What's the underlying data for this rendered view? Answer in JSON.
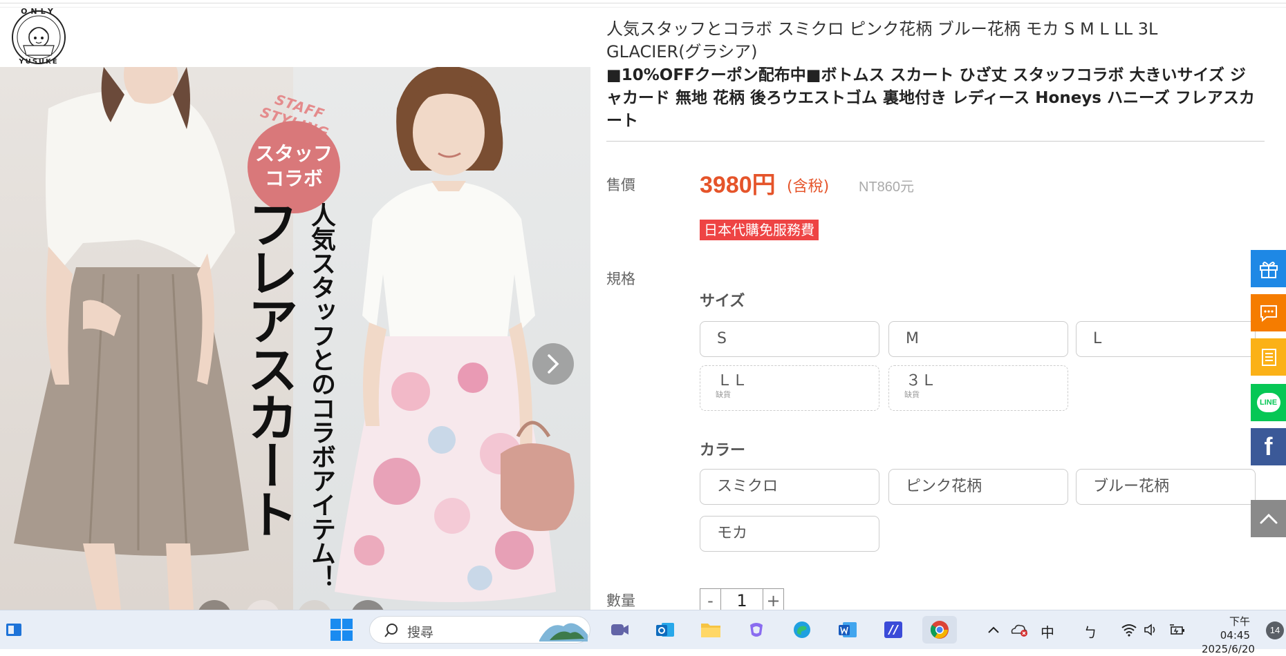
{
  "logo": {
    "top_text": "ONLY",
    "bottom_text": "YUSUKE"
  },
  "product": {
    "title": "人気スタッフとコラボ スミクロ ピンク花柄 ブルー花柄 モカ S M L LL 3L GLACIER(グラシア)",
    "subtitle": "■10%OFFクーポン配布中■ボトムス スカート ひざ丈 スタッフコラボ 大きいサイズ ジャカード 無地 花柄 後ろウエストゴム 裏地付き レディース Honeys ハニーズ フレアスカート"
  },
  "hero": {
    "staff_styling": "STAFF STYLING",
    "badge_line1": "スタッフ",
    "badge_line2": "コラボ",
    "vertical_big": "フレアスカート",
    "vertical_small": "人気スタッフとのコラボアイテム！",
    "next_icon": "chevron-right-icon"
  },
  "pricing": {
    "label": "售價",
    "price": "3980円",
    "tax": "(含稅)",
    "nt": "NT860元",
    "service_badge": "日本代購免服務費"
  },
  "spec": {
    "label": "規格",
    "size_heading": "サイズ",
    "sizes": [
      {
        "label": "S",
        "note": ""
      },
      {
        "label": "M",
        "note": ""
      },
      {
        "label": "L",
        "note": ""
      },
      {
        "label": "ＬＬ",
        "note": "缺貨"
      },
      {
        "label": "３Ｌ",
        "note": "缺貨"
      }
    ],
    "color_heading": "カラー",
    "colors": [
      "スミクロ",
      "ピンク花柄",
      "ブルー花柄",
      "モカ"
    ]
  },
  "quantity": {
    "label": "數量",
    "minus": "-",
    "value": "1",
    "plus": "+"
  },
  "side_buttons": [
    {
      "icon": "gift-icon",
      "color": "#1e88e5"
    },
    {
      "icon": "chat-icon",
      "color": "#f57c00"
    },
    {
      "icon": "notes-icon",
      "color": "#fbb117"
    },
    {
      "icon": "line-icon",
      "label": "LINE",
      "color": "#06c755"
    },
    {
      "icon": "facebook-icon",
      "label": "f",
      "color": "#3b5998"
    },
    {
      "icon": "back-to-top-icon",
      "color": "#8a8a8a"
    }
  ],
  "taskbar": {
    "search_placeholder": "搜尋",
    "ime": "中",
    "ime2": "ㄅ",
    "time_period": "下午 04:45",
    "date": "2025/6/20",
    "notifications": "14"
  }
}
